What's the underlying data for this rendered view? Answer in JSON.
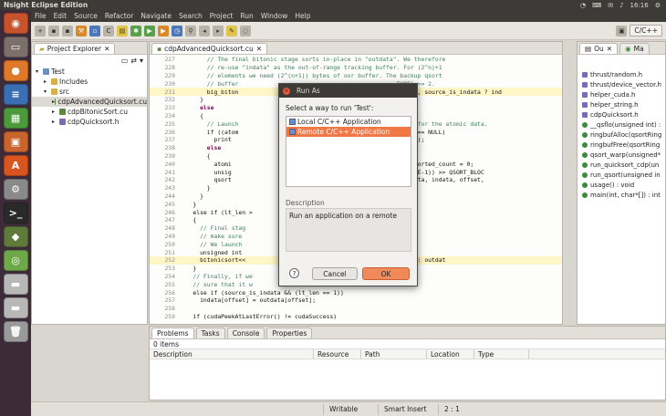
{
  "topbar": {
    "title": "Nsight Eclipse Edition",
    "time": "16:16"
  },
  "menu": [
    "File",
    "Edit",
    "Source",
    "Refactor",
    "Navigate",
    "Search",
    "Project",
    "Run",
    "Window",
    "Help"
  ],
  "perspective": {
    "label": "C/C++"
  },
  "explorer": {
    "tab": "Project Explorer",
    "items": [
      {
        "label": "Test",
        "indent": 0,
        "kind": "project"
      },
      {
        "label": "Includes",
        "indent": 1,
        "kind": "folder"
      },
      {
        "label": "src",
        "indent": 1,
        "kind": "folder"
      },
      {
        "label": "cdpAdvancedQuicksort.cu",
        "indent": 2,
        "kind": "file",
        "selected": true
      },
      {
        "label": "cdpBitonicSort.cu",
        "indent": 2,
        "kind": "file"
      },
      {
        "label": "cdpQuicksort.h",
        "indent": 2,
        "kind": "header"
      }
    ]
  },
  "editor": {
    "tab": "cdpAdvancedQuicksort.cu",
    "lines": [
      {
        "n": "227",
        "t": "        // The final bitonic stage sorts in-place in \"outdata\". We therefore",
        "c": "cm"
      },
      {
        "n": "228",
        "t": "        // re-use \"indata\" as the out-of-range tracking buffer. For (2^n)+1",
        "c": "cm"
      },
      {
        "n": "229",
        "t": "        // elements we need (2^(n+1)) bytes of oor buffer. The backup qsort",
        "c": "cm"
      },
      {
        "n": "230",
        "t": "        // buffer                                             TYPE) >= 2.",
        "c": "cm"
      },
      {
        "n": "231",
        "t": "        big_biton                                  tream >>>(outdata, source_is_indata ? ind",
        "c": "tx",
        "hl": true
      },
      {
        "n": "232",
        "t": "      }",
        "c": "tx"
      },
      {
        "n": "233",
        "t": "      else",
        "c": "kw"
      },
      {
        "n": "234",
        "t": "      {",
        "c": "tx"
      },
      {
        "n": "235",
        "t": "        // Launch                                  ate more storage for the atomic data.",
        "c": "cm"
      },
      {
        "n": "236",
        "t": "        if ((atom                               >(atomicDataStack)) == NULL)",
        "c": "tx"
      },
      {
        "n": "237",
        "t": "          print                                 eft child launch.\\n\");",
        "c": "tx"
      },
      {
        "n": "238",
        "t": "        else",
        "c": "kw"
      },
      {
        "n": "239",
        "t": "        {",
        "c": "tx"
      },
      {
        "n": "240",
        "t": "          atomi                                 fset = atomicData->sorted_count = 0;",
        "c": "tx"
      },
      {
        "n": "241",
        "t": "          unsig                                 _len+(QSORT_BLOCKSIZE-1)) >> QSORT_BLOC",
        "c": "tx"
      },
      {
        "n": "242",
        "t": "          qsort                                 0, lstream >>>(outdata, indata, offset,",
        "c": "tx"
      },
      {
        "n": "243",
        "t": "        }",
        "c": "tx"
      },
      {
        "n": "244",
        "t": "      }",
        "c": "tx"
      },
      {
        "n": "245",
        "t": "    }",
        "c": "tx"
      },
      {
        "n": "246",
        "t": "    else if (lt_len >",
        "c": "tx"
      },
      {
        "n": "247",
        "t": "    {",
        "c": "tx"
      },
      {
        "n": "248",
        "t": "      // Final stag                             mportant to",
        "c": "cm"
      },
      {
        "n": "249",
        "t": "      // make sure                              t (original) buffer.",
        "c": "cm"
      },
      {
        "n": "250",
        "t": "      // We launch                              eads that we can.",
        "c": "cm"
      },
      {
        "n": "251",
        "t": "      unsigned int                              +1);",
        "c": "tx"
      },
      {
        "n": "252",
        "t": "      bitonicsort<<                             _is_indata ? indata : outdat",
        "c": "tx",
        "hl": true
      },
      {
        "n": "253",
        "t": "    }",
        "c": "tx"
      },
      {
        "n": "254",
        "t": "    // Finally, if we                           must still make",
        "c": "cm"
      },
      {
        "n": "255",
        "t": "    // sure that it w",
        "c": "cm"
      },
      {
        "n": "256",
        "t": "    else if (source_is_indata && (lt_len == 1))",
        "c": "tx"
      },
      {
        "n": "257",
        "t": "      indata[offset] = outdata[offset];",
        "c": "tx"
      },
      {
        "n": "258",
        "t": "",
        "c": "tx"
      },
      {
        "n": "259",
        "t": "    if (cudaPeekAtLastError() != cudaSuccess)",
        "c": "tx"
      }
    ]
  },
  "outline": {
    "tabs": [
      "Ou",
      "Ma"
    ],
    "items": [
      {
        "label": "thrust/random.h",
        "kind": "h"
      },
      {
        "label": "thrust/device_vector.h",
        "kind": "h"
      },
      {
        "label": "helper_cuda.h",
        "kind": "h"
      },
      {
        "label": "helper_string.h",
        "kind": "h"
      },
      {
        "label": "cdpQuicksort.h",
        "kind": "h"
      },
      {
        "label": "__qsflo(unsigned int) :",
        "kind": "f"
      },
      {
        "label": "ringbufAlloc(qsortRing",
        "kind": "f"
      },
      {
        "label": "ringbufFree(qsortRing",
        "kind": "f"
      },
      {
        "label": "qsort_warp(unsigned*",
        "kind": "f"
      },
      {
        "label": "run_quicksort_cdp(un",
        "kind": "f"
      },
      {
        "label": "run_qsort(unsigned in",
        "kind": "f"
      },
      {
        "label": "usage() : void",
        "kind": "f"
      },
      {
        "label": "main(int, char*[]) : int",
        "kind": "f"
      }
    ]
  },
  "problems": {
    "tabs": [
      "Problems",
      "Tasks",
      "Console",
      "Properties"
    ],
    "count": "0 items",
    "columns": [
      "Description",
      "Resource",
      "Path",
      "Location",
      "Type"
    ]
  },
  "status": {
    "mode": "Writable",
    "insert": "Smart Insert",
    "pos": "2 : 1"
  },
  "dialog": {
    "title": "Run As",
    "prompt": "Select a way to run 'Test':",
    "options": [
      {
        "label": "Local C/C++ Application",
        "selected": false
      },
      {
        "label": "Remote C/C++ Application",
        "selected": true
      }
    ],
    "description_label": "Description",
    "description": "Run an application on a remote",
    "cancel": "Cancel",
    "ok": "OK"
  },
  "colors": {
    "accent": "#f07746",
    "launcher": "#3d2b3a",
    "panel_dark": "#3c3b37"
  }
}
